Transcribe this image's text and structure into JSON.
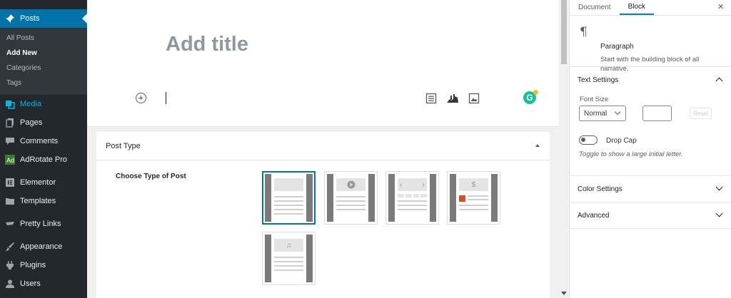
{
  "admin_menu": {
    "posts": "Posts",
    "posts_sub": [
      "All Posts",
      "Add New",
      "Categories",
      "Tags"
    ],
    "media": "Media",
    "pages": "Pages",
    "comments": "Comments",
    "adrotate": "AdRotate Pro",
    "elementor": "Elementor",
    "templates": "Templates",
    "pretty_links": "Pretty Links",
    "appearance": "Appearance",
    "plugins": "Plugins",
    "users": "Users"
  },
  "editor": {
    "title_placeholder": "Add title",
    "toolbar_icons": [
      "block-inserter-icon",
      "table-of-contents-icon",
      "chart-icon",
      "image-icon",
      "grammarly-icon"
    ],
    "grammarly_letter": "G"
  },
  "metabox": {
    "title": "Post Type",
    "choose_label": "Choose Type of Post",
    "post_types": [
      "standard",
      "video",
      "gallery",
      "review",
      "audio"
    ],
    "selected": "standard"
  },
  "settings": {
    "tabs": [
      "Document",
      "Block"
    ],
    "active_tab": "Block",
    "block_name": "Paragraph",
    "block_description": "Start with the building block of all narrative.",
    "panels": {
      "text_settings": "Text Settings",
      "color_settings": "Color Settings",
      "advanced": "Advanced"
    },
    "font_size_label": "Font Size",
    "font_size_value": "Normal",
    "reset_label": "Reset",
    "drop_cap_label": "Drop Cap",
    "drop_cap_help": "Toggle to show a large initial letter."
  },
  "colors": {
    "admin_bg": "#23282d",
    "admin_active": "#0073aa",
    "media_accent": "#00b9eb",
    "selected_border": "#0073aa",
    "grammarly": "#15c39a"
  }
}
